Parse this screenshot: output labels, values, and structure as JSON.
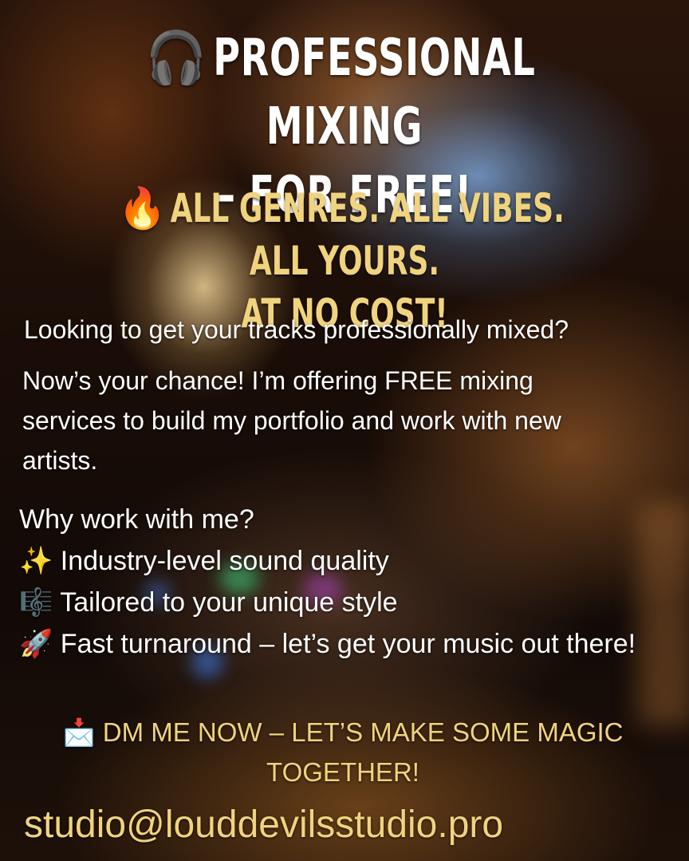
{
  "headline": {
    "emoji": "🎧",
    "line1": "PROFESSIONAL MIXING",
    "line2": "– FOR FREE!"
  },
  "subheadline": {
    "emoji": "🔥",
    "line1": "ALL GENRES. ALL VIBES. ALL YOURS.",
    "line2": "AT NO COST!"
  },
  "intro": "Looking to get your tracks professionally mixed?",
  "offer": "Now’s your chance! I’m offering FREE mixing services to build my portfolio and work with new artists.",
  "why": {
    "heading": "Why work with me?",
    "items": [
      {
        "emoji": "✨",
        "text": "Industry-level sound quality"
      },
      {
        "emoji": "🎼",
        "text": "Tailored to your unique style"
      },
      {
        "emoji": "🚀",
        "text": "Fast turnaround – let’s get your music out there!"
      }
    ]
  },
  "cta": {
    "emoji": "📩",
    "text": "DM ME NOW – LET’S MAKE SOME MAGIC TOGETHER!"
  },
  "email": "studio@louddevilsstudio.pro",
  "colors": {
    "accent": "#f0d37e",
    "text": "#ffffff"
  }
}
